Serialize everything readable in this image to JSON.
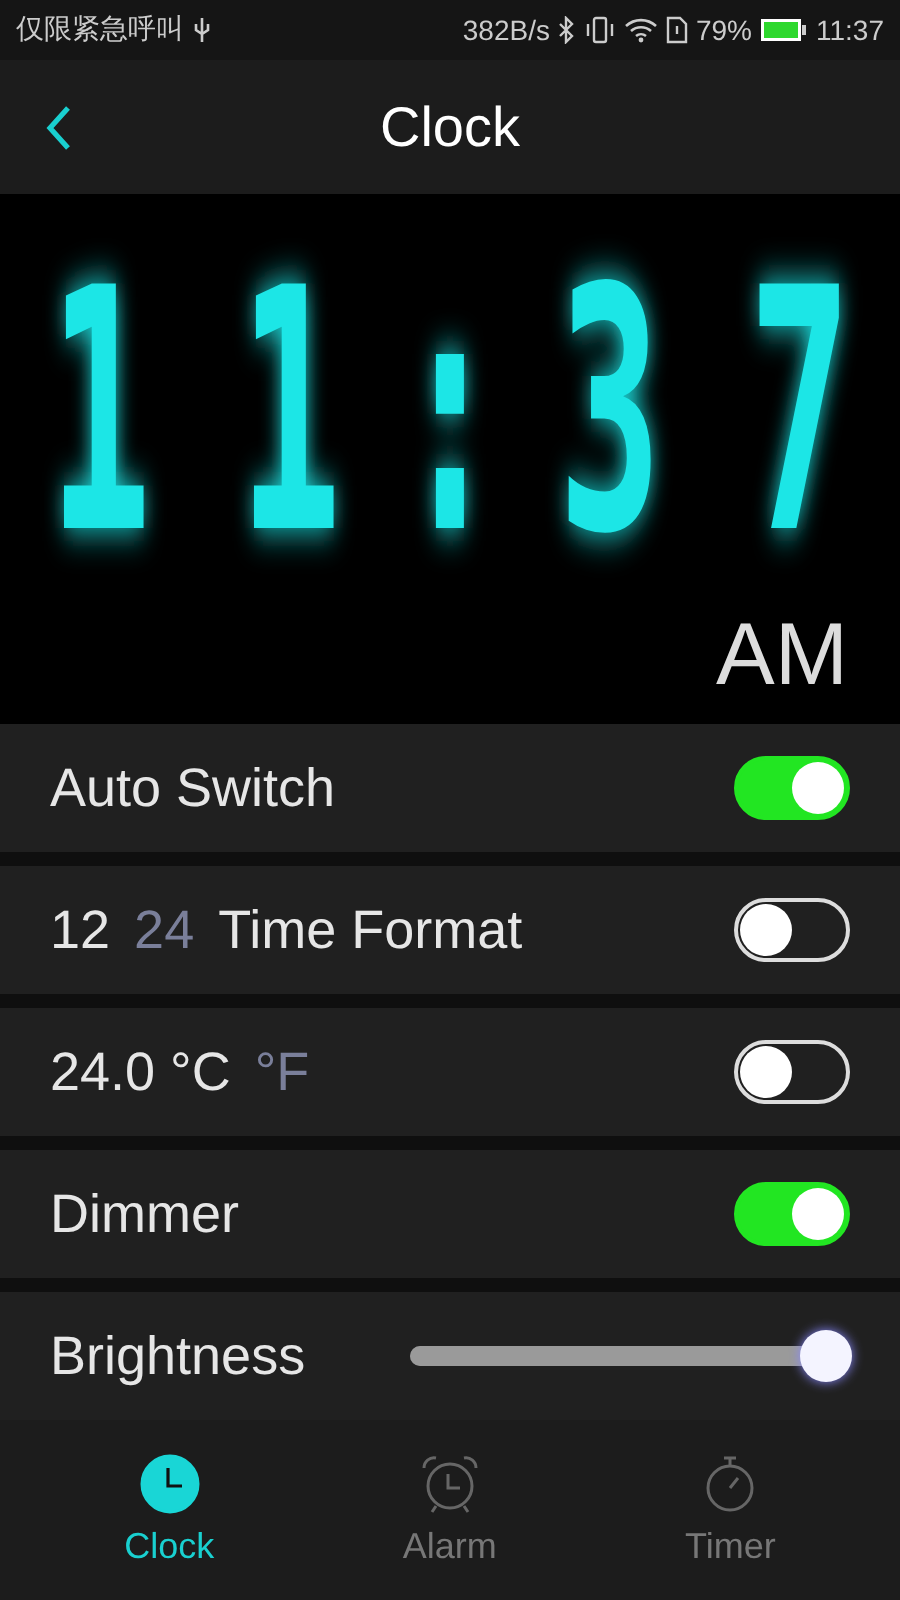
{
  "status_bar": {
    "carrier": "仅限紧急呼叫",
    "speed": "382B/s",
    "battery": "79%",
    "time": "11:37"
  },
  "header": {
    "title": "Clock"
  },
  "clock": {
    "time": "11:37",
    "period": "AM"
  },
  "settings": [
    {
      "kind": "toggle",
      "label": "Auto Switch",
      "on": true
    },
    {
      "kind": "choice-toggle",
      "options": [
        {
          "label": "12",
          "selected": true
        },
        {
          "label": "24",
          "selected": false
        }
      ],
      "label": "Time Format",
      "on": false
    },
    {
      "kind": "choice-toggle",
      "options": [
        {
          "label": "24.0 °C",
          "selected": true
        },
        {
          "label": "°F",
          "selected": false
        }
      ],
      "on": false
    },
    {
      "kind": "toggle",
      "label": "Dimmer",
      "on": true
    },
    {
      "kind": "slider",
      "label": "Brightness",
      "level": 0.98
    }
  ],
  "nav": [
    {
      "kind": "clock",
      "label": "Clock",
      "selected": true
    },
    {
      "kind": "alarm",
      "label": "Alarm",
      "selected": false
    },
    {
      "kind": "timer",
      "label": "Timer",
      "selected": false
    }
  ]
}
